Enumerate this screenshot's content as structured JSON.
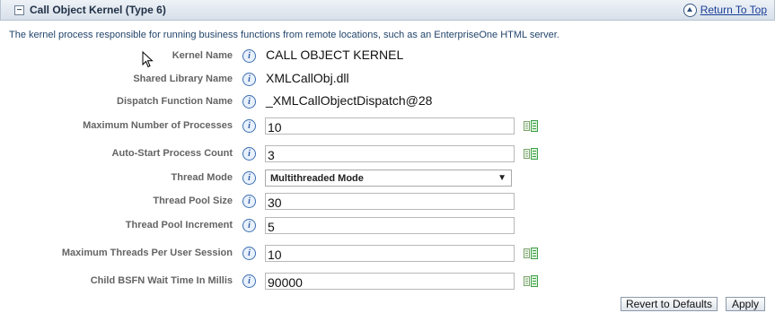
{
  "section": {
    "title": "Call Object Kernel (Type 6)",
    "collapse_glyph": "−",
    "return_link": "Return To Top",
    "description": "The kernel process responsible for running business functions from remote locations, such as an EnterpriseOne HTML server."
  },
  "icons": {
    "info_glyph": "i",
    "info": "info-icon",
    "detail": "details-icon",
    "up": "up-arrow-icon",
    "cursor": "mouse-pointer-icon"
  },
  "fields": {
    "kernel_name": {
      "label": "Kernel Name",
      "value": "CALL OBJECT KERNEL"
    },
    "shared_library_name": {
      "label": "Shared Library Name",
      "value": "XMLCallObj.dll"
    },
    "dispatch_function_name": {
      "label": "Dispatch Function Name",
      "value": "_XMLCallObjectDispatch@28"
    },
    "max_processes": {
      "label": "Maximum Number of Processes",
      "value": "10"
    },
    "auto_start_count": {
      "label": "Auto-Start Process Count",
      "value": "3"
    },
    "thread_mode": {
      "label": "Thread Mode",
      "value": "Multithreaded Mode",
      "arrow": "▼"
    },
    "thread_pool_size": {
      "label": "Thread Pool Size",
      "value": "30"
    },
    "thread_pool_increment": {
      "label": "Thread Pool Increment",
      "value": "5"
    },
    "max_threads_per_user": {
      "label": "Maximum Threads Per User Session",
      "value": "10"
    },
    "child_bsfn_wait": {
      "label": "Child BSFN Wait Time In Millis",
      "value": "90000"
    }
  },
  "buttons": {
    "revert": "Revert to Defaults",
    "apply": "Apply"
  },
  "colors": {
    "header_gradient_top": "#eef2f7",
    "header_gradient_bottom": "#d7e0ea",
    "label_gray": "#646464",
    "link_blue": "#1b3f99",
    "description_blue": "#23456b",
    "info_blue": "#3c6fb3",
    "detail_green": "#3aa145"
  }
}
